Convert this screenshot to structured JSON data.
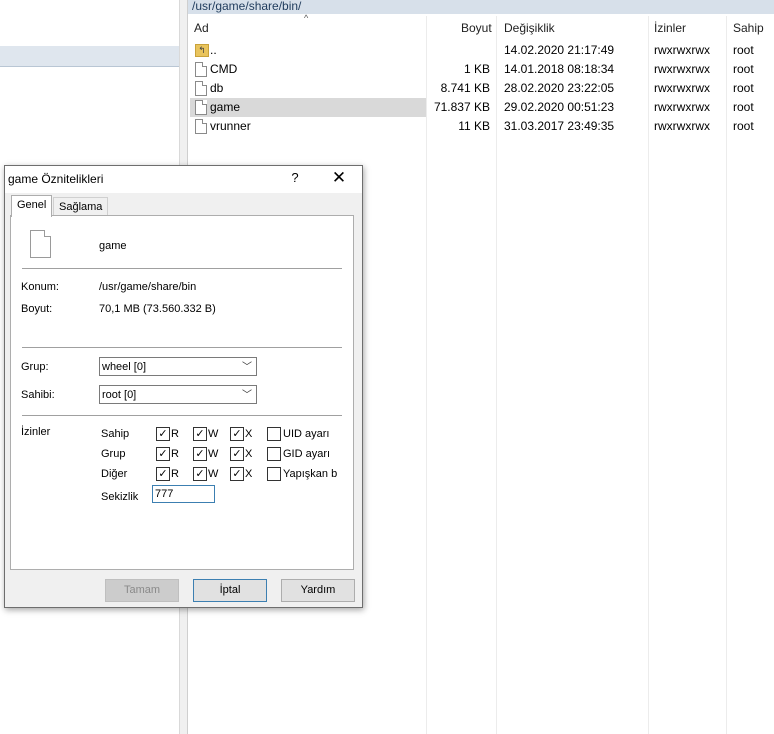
{
  "path_bar": "/usr/game/share/bin/",
  "columns": [
    "Ad",
    "Boyut",
    "Değişiklik",
    "İzinler",
    "Sahip"
  ],
  "files": [
    {
      "name": "..",
      "size": "",
      "modified": "14.02.2020 21:17:49",
      "perms": "rwxrwxrwx",
      "owner": "root",
      "icon": "parent-folder-icon"
    },
    {
      "name": "CMD",
      "size": "1 KB",
      "modified": "14.01.2018 08:18:34",
      "perms": "rwxrwxrwx",
      "owner": "root",
      "icon": "file-icon"
    },
    {
      "name": "db",
      "size": "8.741 KB",
      "modified": "28.02.2020 23:22:05",
      "perms": "rwxrwxrwx",
      "owner": "root",
      "icon": "file-icon"
    },
    {
      "name": "game",
      "size": "71.837 KB",
      "modified": "29.02.2020 00:51:23",
      "perms": "rwxrwxrwx",
      "owner": "root",
      "icon": "file-icon"
    },
    {
      "name": "vrunner",
      "size": "11 KB",
      "modified": "31.03.2017 23:49:35",
      "perms": "rwxrwxrwx",
      "owner": "root",
      "icon": "file-icon"
    }
  ],
  "dialog": {
    "title": "game Öznitelikleri",
    "help": "?",
    "close": "✕",
    "tabs": [
      "Genel",
      "Sağlama"
    ],
    "file_name": "game",
    "location_label": "Konum:",
    "location_value": "/usr/game/share/bin",
    "size_label": "Boyut:",
    "size_value": "70,1 MB (73.560.332 B)",
    "group_label": "Grup:",
    "group_value": "wheel [0]",
    "owner_label": "Sahibi:",
    "owner_value": "root [0]",
    "permissions_label": "İzinler",
    "perm_rows": [
      {
        "label": "Sahip",
        "r": "R",
        "w": "W",
        "x": "X",
        "extra": "UID ayarı"
      },
      {
        "label": "Grup",
        "r": "R",
        "w": "W",
        "x": "X",
        "extra": "GID ayarı"
      },
      {
        "label": "Diğer",
        "r": "R",
        "w": "W",
        "x": "X",
        "extra": "Yapışkan bit"
      }
    ],
    "octal_label": "Sekizlik",
    "octal_value": "777",
    "buttons": {
      "ok": "Tamam",
      "cancel": "İptal",
      "help": "Yardım"
    }
  }
}
